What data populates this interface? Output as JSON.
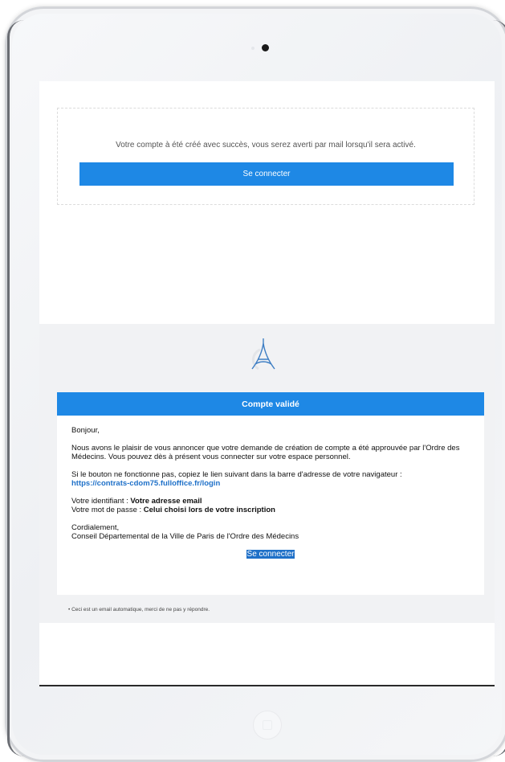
{
  "confirmation": {
    "message": "Votre compte à été créé avec succès, vous serez averti par mail lorsqu'il sera activé.",
    "button_label": "Se connecter"
  },
  "email": {
    "header": "Compte validé",
    "greeting": "Bonjour,",
    "paragraph1": "Nous avons le plaisir de vous annoncer que votre demande de création de compte a été approuvée par l'Ordre des Médecins. Vous pouvez dès à présent vous connecter sur votre espace personnel.",
    "paragraph2_text": "Si le bouton ne fonctionne pas, copiez le lien suivant dans la barre d'adresse de votre navigateur :",
    "link": "https://contrats-cdom75.fulloffice.fr/login",
    "identifier_label": "Votre identifiant :",
    "identifier_value": "Votre adresse email",
    "password_label": "Votre mot de passe :",
    "password_value": "Celui choisi lors de votre inscription",
    "closing": "Cordialement,",
    "signature": "Conseil Départemental de la Ville de Paris de l'Ordre des Médecins",
    "button_label": "Se connecter",
    "footnote": "• Ceci est un email automatique, merci de ne pas y répondre."
  },
  "colors": {
    "accent": "#1e88e5",
    "link": "#1e70c8",
    "email_background": "#f1f2f4"
  },
  "icons": {
    "logo": "eiffel-tower-logo"
  }
}
